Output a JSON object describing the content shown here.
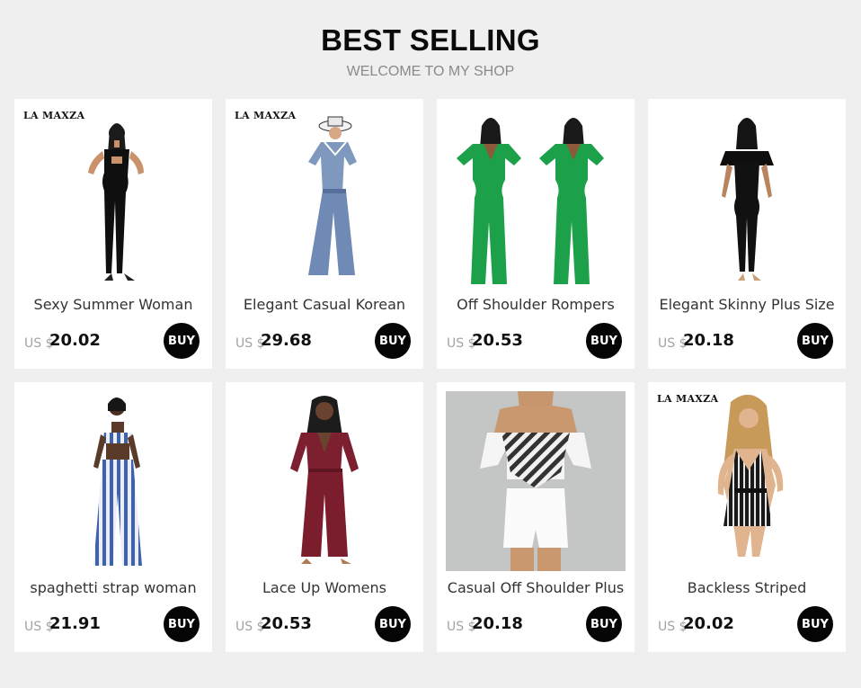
{
  "header": {
    "title": "BEST SELLING",
    "subtitle": "WELCOME TO MY SHOP"
  },
  "products": [
    {
      "name": "Sexy Summer Woman",
      "currency": "US $",
      "price": "20.02",
      "buy_label": "BUY",
      "brand": "LA MAXZA",
      "palette": "#111111"
    },
    {
      "name": "Elegant Casual Korean",
      "currency": "US $",
      "price": "29.68",
      "buy_label": "BUY",
      "brand": "LA MAXZA",
      "palette": "#7d95b8"
    },
    {
      "name": "Off Shoulder Rompers",
      "currency": "US $",
      "price": "20.53",
      "buy_label": "BUY",
      "brand": "",
      "palette": "#1aa54a"
    },
    {
      "name": "Elegant Skinny Plus Size",
      "currency": "US $",
      "price": "20.18",
      "buy_label": "BUY",
      "brand": "",
      "palette": "#111111"
    },
    {
      "name": "spaghetti strap woman",
      "currency": "US $",
      "price": "21.91",
      "buy_label": "BUY",
      "brand": "",
      "palette": "#4a6fb0"
    },
    {
      "name": "Lace Up Womens",
      "currency": "US $",
      "price": "20.53",
      "buy_label": "BUY",
      "brand": "",
      "palette": "#7a1f2e"
    },
    {
      "name": "Casual Off Shoulder Plus",
      "currency": "US $",
      "price": "20.18",
      "buy_label": "BUY",
      "brand": "",
      "palette": "#e8e8e8"
    },
    {
      "name": "Backless Striped",
      "currency": "US $",
      "price": "20.02",
      "buy_label": "BUY",
      "brand": "LA MAXZA",
      "palette": "#1a1a1a"
    }
  ]
}
